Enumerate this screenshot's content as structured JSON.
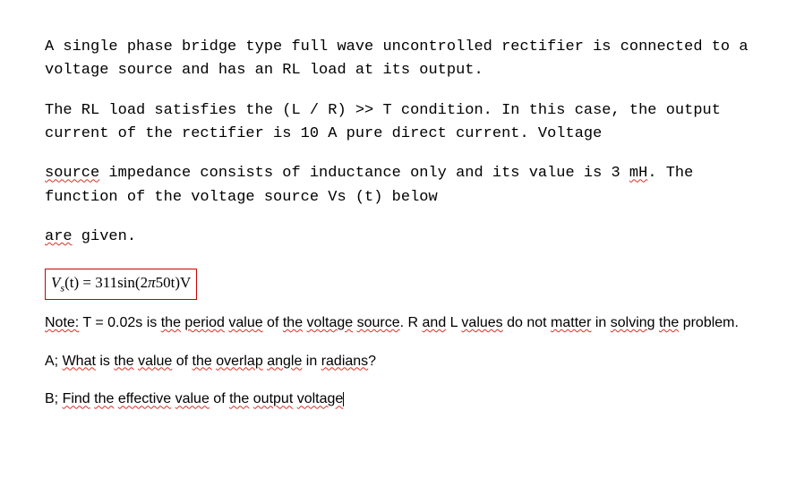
{
  "paragraphs": {
    "p1": "A single phase bridge type full wave uncontrolled rectifier is connected to a voltage source and has an RL load at its output.",
    "p2": "The RL load satisfies the (L / R) >> T condition. In this case, the output current of the rectifier is 10 A pure direct current. Voltage",
    "p3_parts": {
      "w1": "source",
      "t1": " impedance consists of inductance only and its value is 3 ",
      "w2": "mH",
      "t2": ". The function of the voltage source Vs (t) below"
    },
    "p4_parts": {
      "w1": "are",
      "t1": " given."
    }
  },
  "formula": {
    "Vs": "V",
    "sub": "s",
    "func": "(t) = 311sin(2",
    "pi": "π",
    "tail": "50t)V"
  },
  "note": {
    "prefix": "Note:",
    "t1": " T = 0.02s is ",
    "w1": "the",
    "t2": " ",
    "w2": "period",
    "t3": " ",
    "w3": "value",
    "t4": " of ",
    "w4": "the",
    "t5": " ",
    "w5": "voltage",
    "t6": " ",
    "w6": "source",
    "t7": ". R ",
    "w7": "and",
    "t8": " L ",
    "w8": "values",
    "t9": " do not ",
    "w9": "matter",
    "t10": " in ",
    "w10": "solving",
    "t11": " ",
    "w11": "the",
    "t12": " problem."
  },
  "qA": {
    "prefix": "A; ",
    "w1": "What",
    "t1": " is ",
    "w2": "the",
    "t2": " ",
    "w3": "value",
    "t3": " of ",
    "w4": "the",
    "t4": " ",
    "w5": "overlap",
    "t5": " ",
    "w6": "angle",
    "t6": " in ",
    "w7": "radians",
    "t7": "?"
  },
  "qB": {
    "prefix": "B; ",
    "w1": "Find",
    "t1": " ",
    "w2": "the",
    "t2": " ",
    "w3": "effective",
    "t3": " ",
    "w4": "value",
    "t4": " of ",
    "w5": "the",
    "t5": " ",
    "w6": "output",
    "t6": " ",
    "w7": "voltage"
  }
}
